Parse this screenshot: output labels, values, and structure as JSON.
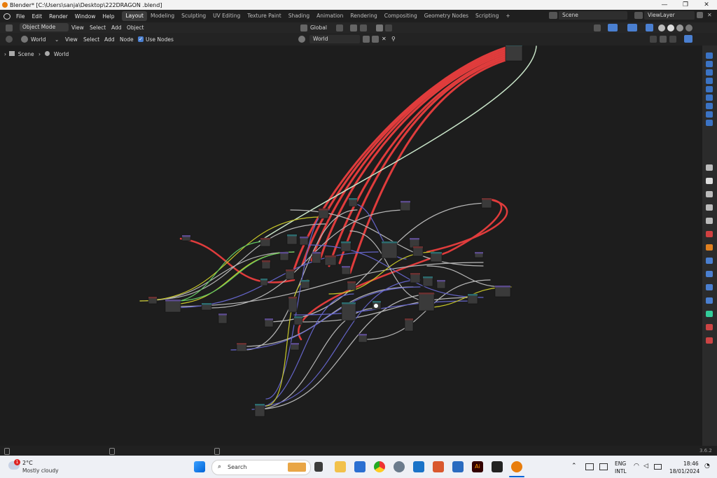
{
  "window": {
    "title": "Blender* [C:\\Users\\sanja\\Desktop\\222DRAGON .blend]",
    "minimize": "—",
    "maximize": "❐",
    "close": "✕"
  },
  "menubar": {
    "items": [
      "File",
      "Edit",
      "Render",
      "Window",
      "Help"
    ],
    "workspaces": [
      "Layout",
      "Modeling",
      "Sculpting",
      "UV Editing",
      "Texture Paint",
      "Shading",
      "Animation",
      "Rendering",
      "Compositing",
      "Geometry Nodes",
      "Scripting"
    ],
    "add_tab": "+",
    "scene_label": "Scene",
    "viewlayer_label": "ViewLayer"
  },
  "header": {
    "mode": "Object Mode",
    "menus": [
      "View",
      "Select",
      "Add",
      "Object"
    ],
    "transform_orientation": "Global"
  },
  "node_header": {
    "world_type": "World",
    "menus": [
      "View",
      "Select",
      "Add",
      "Node"
    ],
    "use_nodes_label": "Use Nodes",
    "use_nodes_checked": true,
    "world_name": "World"
  },
  "breadcrumb": {
    "scene": "Scene",
    "world": "World"
  },
  "status": {
    "version": "3.6.2"
  },
  "taskbar": {
    "weather_temp": "2°C",
    "weather_desc": "Mostly cloudy",
    "search_placeholder": "Search",
    "lang_top": "ENG",
    "lang_bottom": "INTL",
    "time": "18:46",
    "date": "18/01/2024",
    "notification_count": "1"
  },
  "colors": {
    "red_link": "#e03c3c",
    "grey_link": "#b7b7b7",
    "blue_link": "#6464c8",
    "yellow_link": "#c7c729",
    "green_link": "#63c763",
    "pale_link": "#c9e5c9"
  }
}
